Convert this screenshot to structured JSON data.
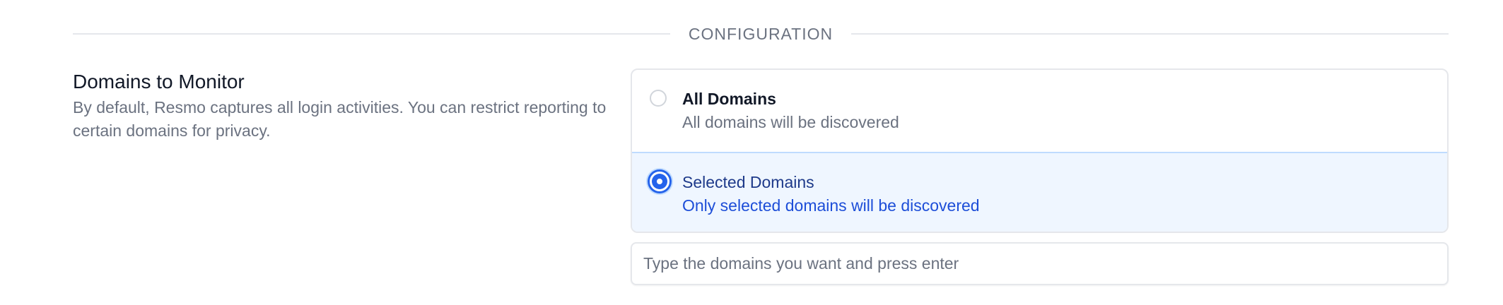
{
  "section": {
    "title": "CONFIGURATION"
  },
  "field": {
    "title": "Domains to Monitor",
    "description": "By default, Resmo captures all login activities. You can restrict reporting to certain domains for privacy."
  },
  "radio_options": [
    {
      "label": "All Domains",
      "sublabel": "All domains will be discovered",
      "selected": false
    },
    {
      "label": "Selected Domains",
      "sublabel": "Only selected domains will be discovered",
      "selected": true
    }
  ],
  "domain_input": {
    "placeholder": "Type the domains you want and press enter",
    "value": ""
  },
  "colors": {
    "accent": "#2563eb",
    "selected_bg": "#eff6ff",
    "selected_label": "#1e3a8a",
    "selected_sublabel": "#1d4ed8",
    "muted_text": "#6b7280",
    "border": "#e5e7eb"
  }
}
